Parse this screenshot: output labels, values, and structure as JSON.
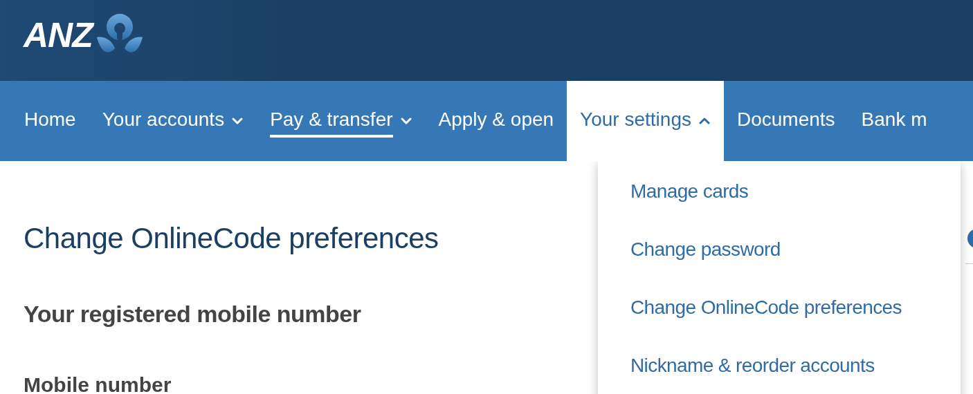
{
  "header": {
    "logo_text": "ANZ"
  },
  "nav": [
    {
      "label": "Home",
      "kind": "link",
      "selected": false,
      "expanded": false
    },
    {
      "label": "Your accounts",
      "kind": "menu",
      "selected": false,
      "expanded": false
    },
    {
      "label": "Pay & transfer",
      "kind": "menu",
      "selected": true,
      "expanded": false
    },
    {
      "label": "Apply & open",
      "kind": "link",
      "selected": false,
      "expanded": false
    },
    {
      "label": "Your settings",
      "kind": "menu",
      "selected": false,
      "expanded": true
    },
    {
      "label": "Documents",
      "kind": "link",
      "selected": false,
      "expanded": false
    },
    {
      "label": "Bank m",
      "kind": "link",
      "selected": false,
      "expanded": false
    }
  ],
  "settings_menu": {
    "items": [
      "Manage cards",
      "Change password",
      "Change OnlineCode preferences",
      "Nickname & reorder accounts"
    ]
  },
  "content": {
    "title": "Change OnlineCode preferences",
    "section_heading": "Your registered mobile number",
    "field_label": "Mobile number"
  }
}
